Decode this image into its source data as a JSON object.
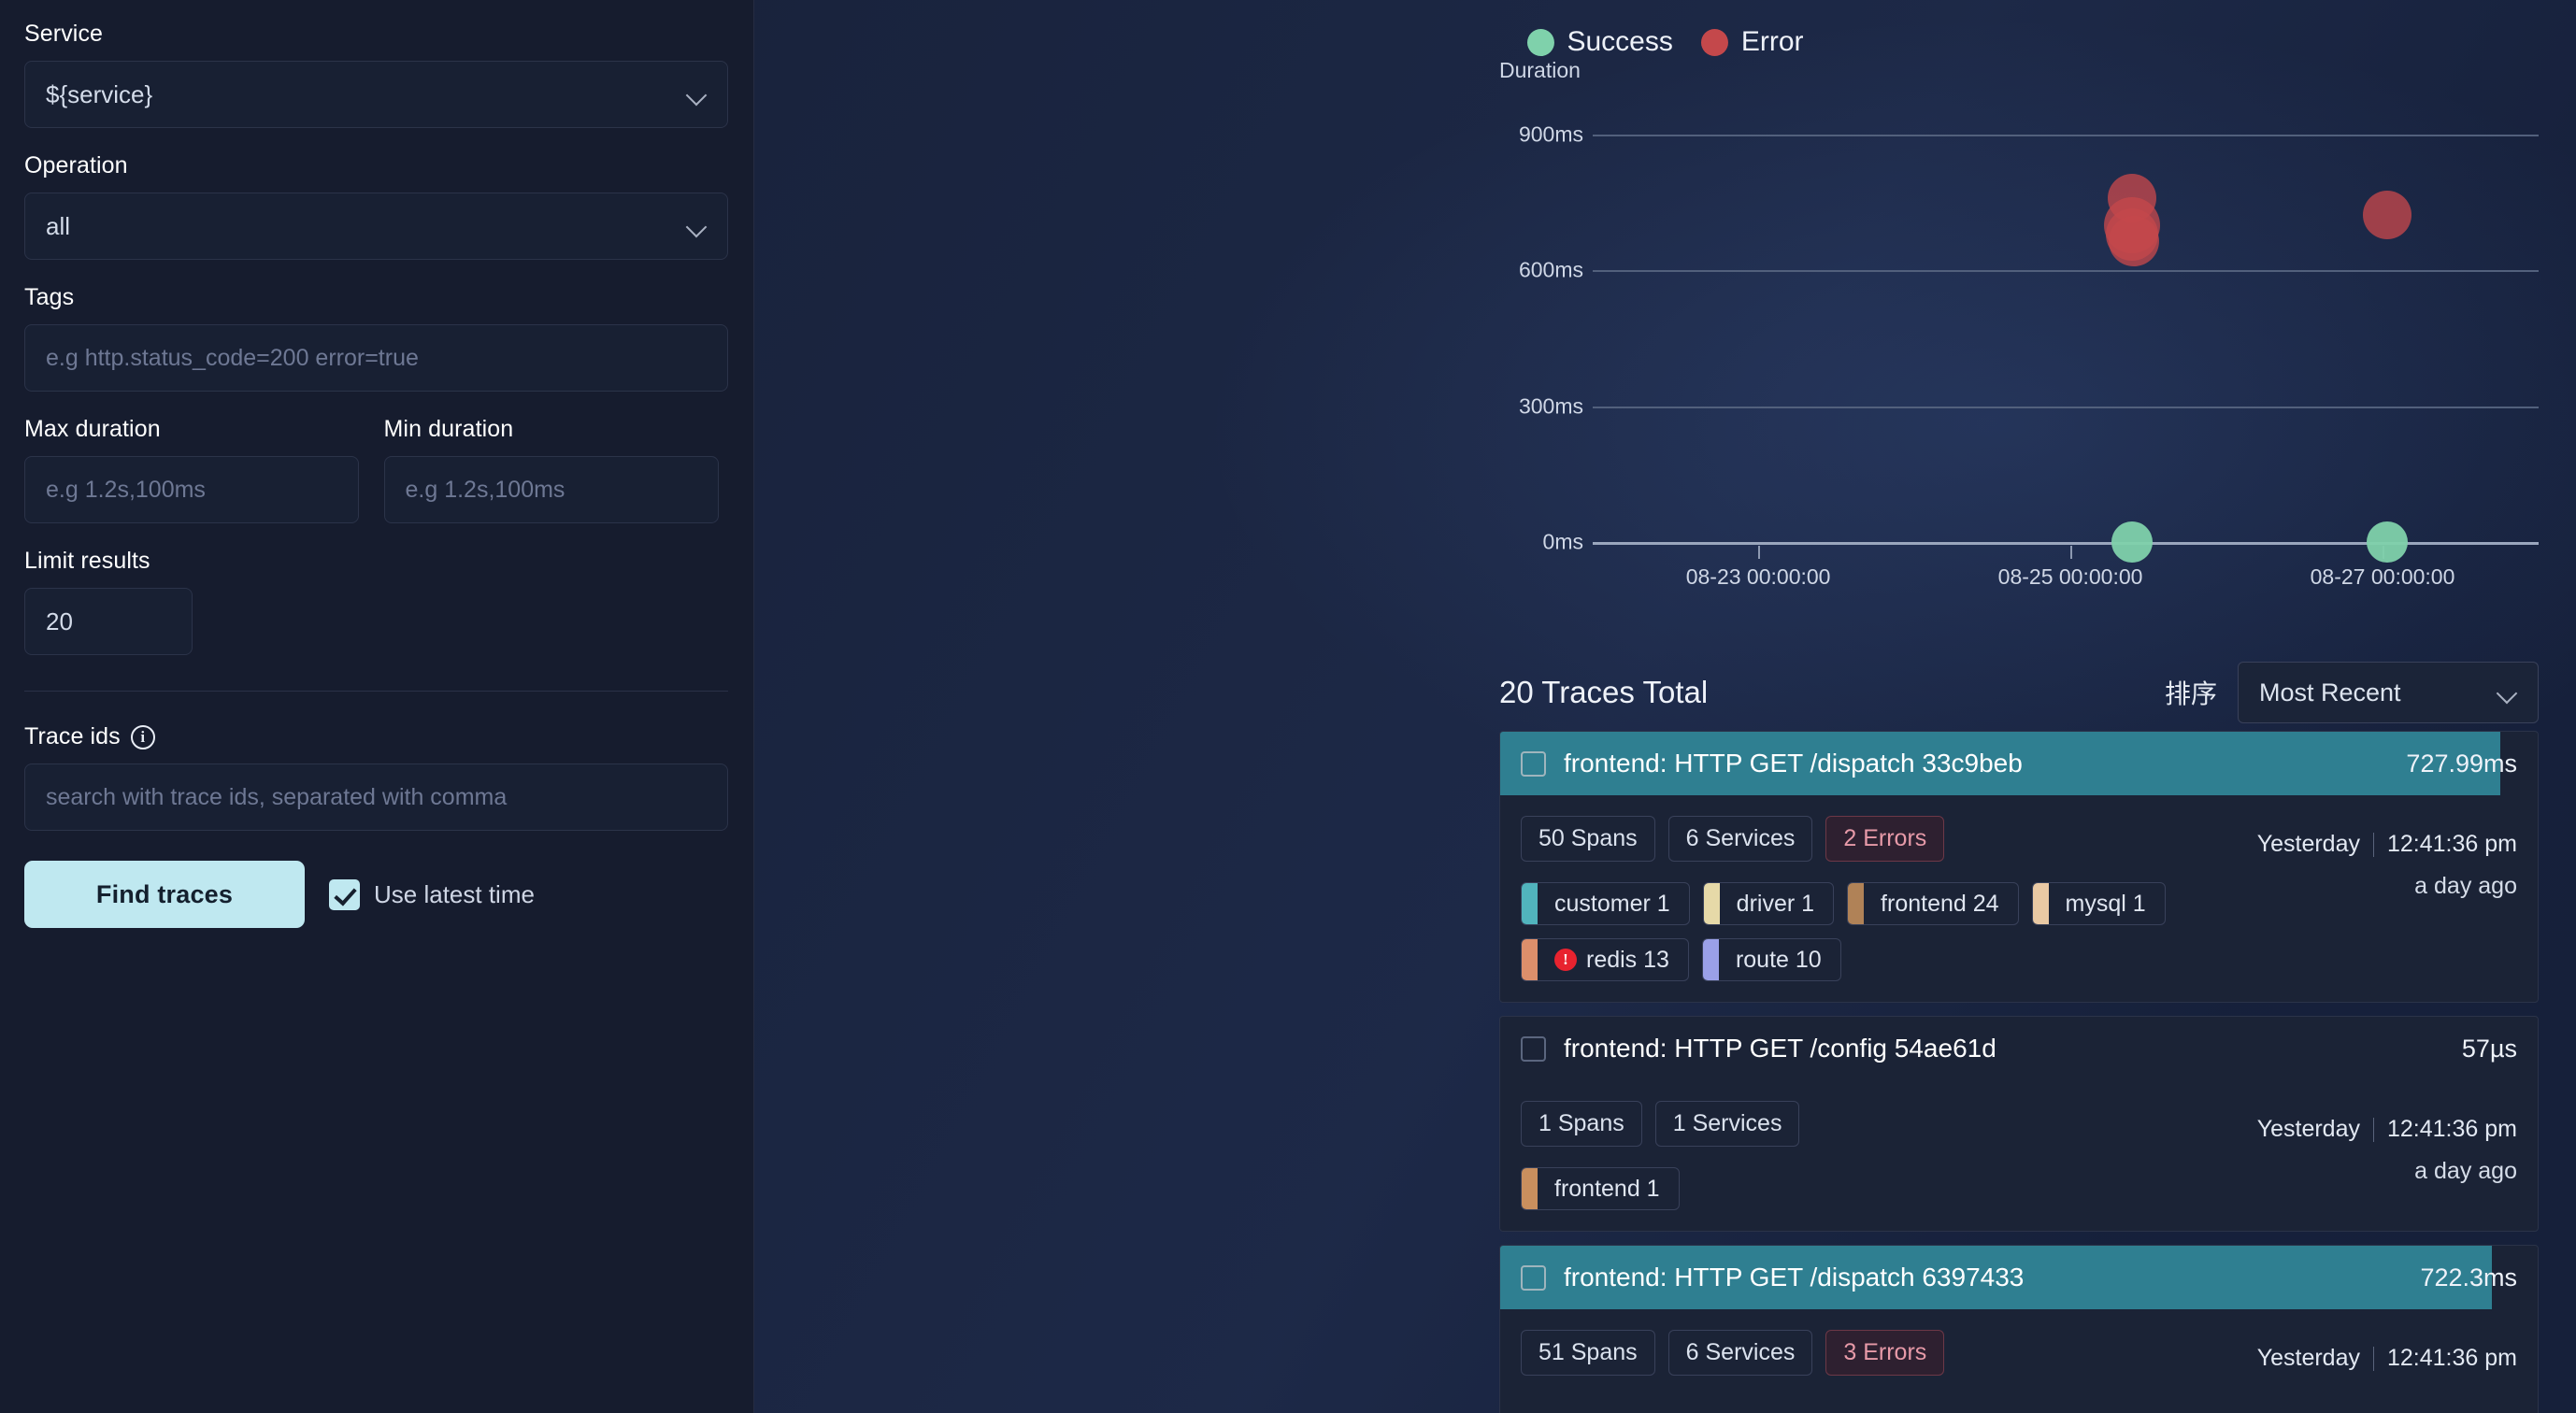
{
  "sidebar": {
    "service": {
      "label": "Service",
      "value": "${service}",
      "icon": "chevron-down-icon"
    },
    "operation": {
      "label": "Operation",
      "value": "all",
      "icon": "chevron-down-icon"
    },
    "tags": {
      "label": "Tags",
      "placeholder": "e.g http.status_code=200 error=true",
      "value": ""
    },
    "max_duration": {
      "label": "Max duration",
      "placeholder": "e.g 1.2s,100ms",
      "value": ""
    },
    "min_duration": {
      "label": "Min duration",
      "placeholder": "e.g 1.2s,100ms",
      "value": ""
    },
    "limit_results": {
      "label": "Limit results",
      "value": "20"
    },
    "trace_ids": {
      "label": "Trace ids",
      "info_icon": "info-icon",
      "placeholder": "search with trace ids, separated with comma",
      "value": ""
    },
    "find_button": "Find traces",
    "use_latest_time": {
      "label": "Use latest time",
      "checked": true
    }
  },
  "chart_data": {
    "type": "scatter",
    "title": "",
    "ylabel": "Duration",
    "xlabel": "",
    "ylim": [
      0,
      900
    ],
    "yticks": [
      "0ms",
      "300ms",
      "600ms",
      "900ms"
    ],
    "ytick_values": [
      0,
      300,
      600,
      900
    ],
    "xticks": [
      "08-23 00:00:00",
      "08-25 00:00:00",
      "08-27 00:00:00"
    ],
    "grid": true,
    "legend_position": "top-center",
    "legend": [
      {
        "name": "Success",
        "color": "#7fd1ab"
      },
      {
        "name": "Error",
        "color": "#c4484b"
      }
    ],
    "series": [
      {
        "name": "Error",
        "color": "#c4484b",
        "points": [
          {
            "x_pct": 57.0,
            "y": 760,
            "r": 26
          },
          {
            "x_pct": 57.0,
            "y": 700,
            "r": 30
          },
          {
            "x_pct": 57.0,
            "y": 680,
            "r": 28
          },
          {
            "x_pct": 57.2,
            "y": 665,
            "r": 27
          },
          {
            "x_pct": 84.0,
            "y": 722,
            "r": 26
          }
        ]
      },
      {
        "name": "Success",
        "color": "#7fd1ab",
        "points": [
          {
            "x_pct": 57.0,
            "y": 0,
            "r": 22
          },
          {
            "x_pct": 84.0,
            "y": 0,
            "r": 22
          }
        ]
      }
    ]
  },
  "results": {
    "total_label": "20 Traces Total",
    "sort_label": "排序",
    "sort_value": "Most Recent",
    "sort_icon": "chevron-down-icon",
    "traces": [
      {
        "title": "frontend: HTTP GET /dispatch  33c9beb",
        "duration": "727.99ms",
        "bar_pct": 96.4,
        "highlighted": true,
        "badges": [
          {
            "text": "50 Spans",
            "type": "normal"
          },
          {
            "text": "6 Services",
            "type": "normal"
          },
          {
            "text": "2 Errors",
            "type": "error"
          }
        ],
        "services": [
          {
            "name": "customer 1",
            "color": "#51b4bd",
            "error": false
          },
          {
            "name": "driver 1",
            "color": "#e6d9a8",
            "error": false
          },
          {
            "name": "frontend 24",
            "color": "#b08257",
            "error": false
          },
          {
            "name": "mysql 1",
            "color": "#e9c9a4",
            "error": false
          },
          {
            "name": "redis 13",
            "color": "#dd8f6b",
            "error": true
          },
          {
            "name": "route 10",
            "color": "#9aa0e8",
            "error": false
          }
        ],
        "day": "Yesterday",
        "time": "12:41:36 pm",
        "relative": "a day ago"
      },
      {
        "title": "frontend: HTTP GET /config  54ae61d",
        "duration": "57µs",
        "bar_pct": 0,
        "highlighted": false,
        "badges": [
          {
            "text": "1 Spans",
            "type": "normal"
          },
          {
            "text": "1 Services",
            "type": "normal"
          }
        ],
        "services": [
          {
            "name": "frontend 1",
            "color": "#c98f5e",
            "error": false
          }
        ],
        "day": "Yesterday",
        "time": "12:41:36 pm",
        "relative": "a day ago"
      },
      {
        "title": "frontend: HTTP GET /dispatch  6397433",
        "duration": "722.3ms",
        "bar_pct": 95.6,
        "highlighted": true,
        "badges": [
          {
            "text": "51 Spans",
            "type": "normal"
          },
          {
            "text": "6 Services",
            "type": "normal"
          },
          {
            "text": "3 Errors",
            "type": "error"
          }
        ],
        "services": [],
        "day": "Yesterday",
        "time": "12:41:36 pm",
        "relative": ""
      }
    ]
  },
  "colors": {
    "accent": "#bfe8f0",
    "bar": "#2f7f91",
    "success": "#7fd1ab",
    "error": "#c4484b",
    "panel": "#1b2336",
    "sidebar_bg": "#161c2e"
  }
}
